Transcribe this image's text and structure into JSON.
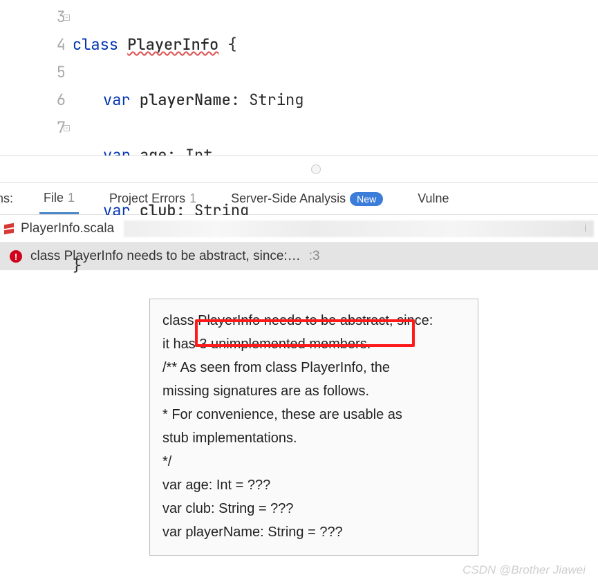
{
  "editor": {
    "lines": {
      "3": {
        "num": "3",
        "kw": "class",
        "name": "PlayerInfo",
        "brace": " {"
      },
      "4": {
        "num": "4",
        "kw": "var",
        "name": "playerName",
        "colon": ": ",
        "type": "String"
      },
      "5": {
        "num": "5",
        "kw": "var",
        "name": "age",
        "colon": ": ",
        "type": "Int"
      },
      "6": {
        "num": "6",
        "kw": "var",
        "name": "club",
        "colon": ": ",
        "type": "String"
      },
      "7": {
        "num": "7",
        "brace": "}"
      }
    }
  },
  "tabs": {
    "left_cut": "ems:",
    "file": {
      "label": "File",
      "count": "1"
    },
    "project": {
      "label": "Project Errors",
      "count": "1"
    },
    "server": {
      "label": "Server-Side Analysis",
      "badge": "New"
    },
    "vuln": {
      "label": "Vulne"
    }
  },
  "filebar": {
    "filename": "PlayerInfo.scala",
    "right_cut": "i"
  },
  "error_row": {
    "message": "class PlayerInfo needs to be abstract, since:…",
    "line_ref": ":3"
  },
  "tooltip": {
    "l1a": "class PlayerInfo needs to be abstract, since:",
    "l2a": "it has ",
    "l2b": "3 unimplemented members.",
    "l3": "/** As seen from class PlayerInfo, the",
    "l4": "missing signatures are as follows.",
    "l5": "* For convenience, these are usable as",
    "l6": "stub implementations.",
    "l7": "*/",
    "l8": "var age: Int = ???",
    "l9": "var club: String = ???",
    "l10": "var playerName: String = ???"
  },
  "watermark": "CSDN @Brother Jiawei"
}
